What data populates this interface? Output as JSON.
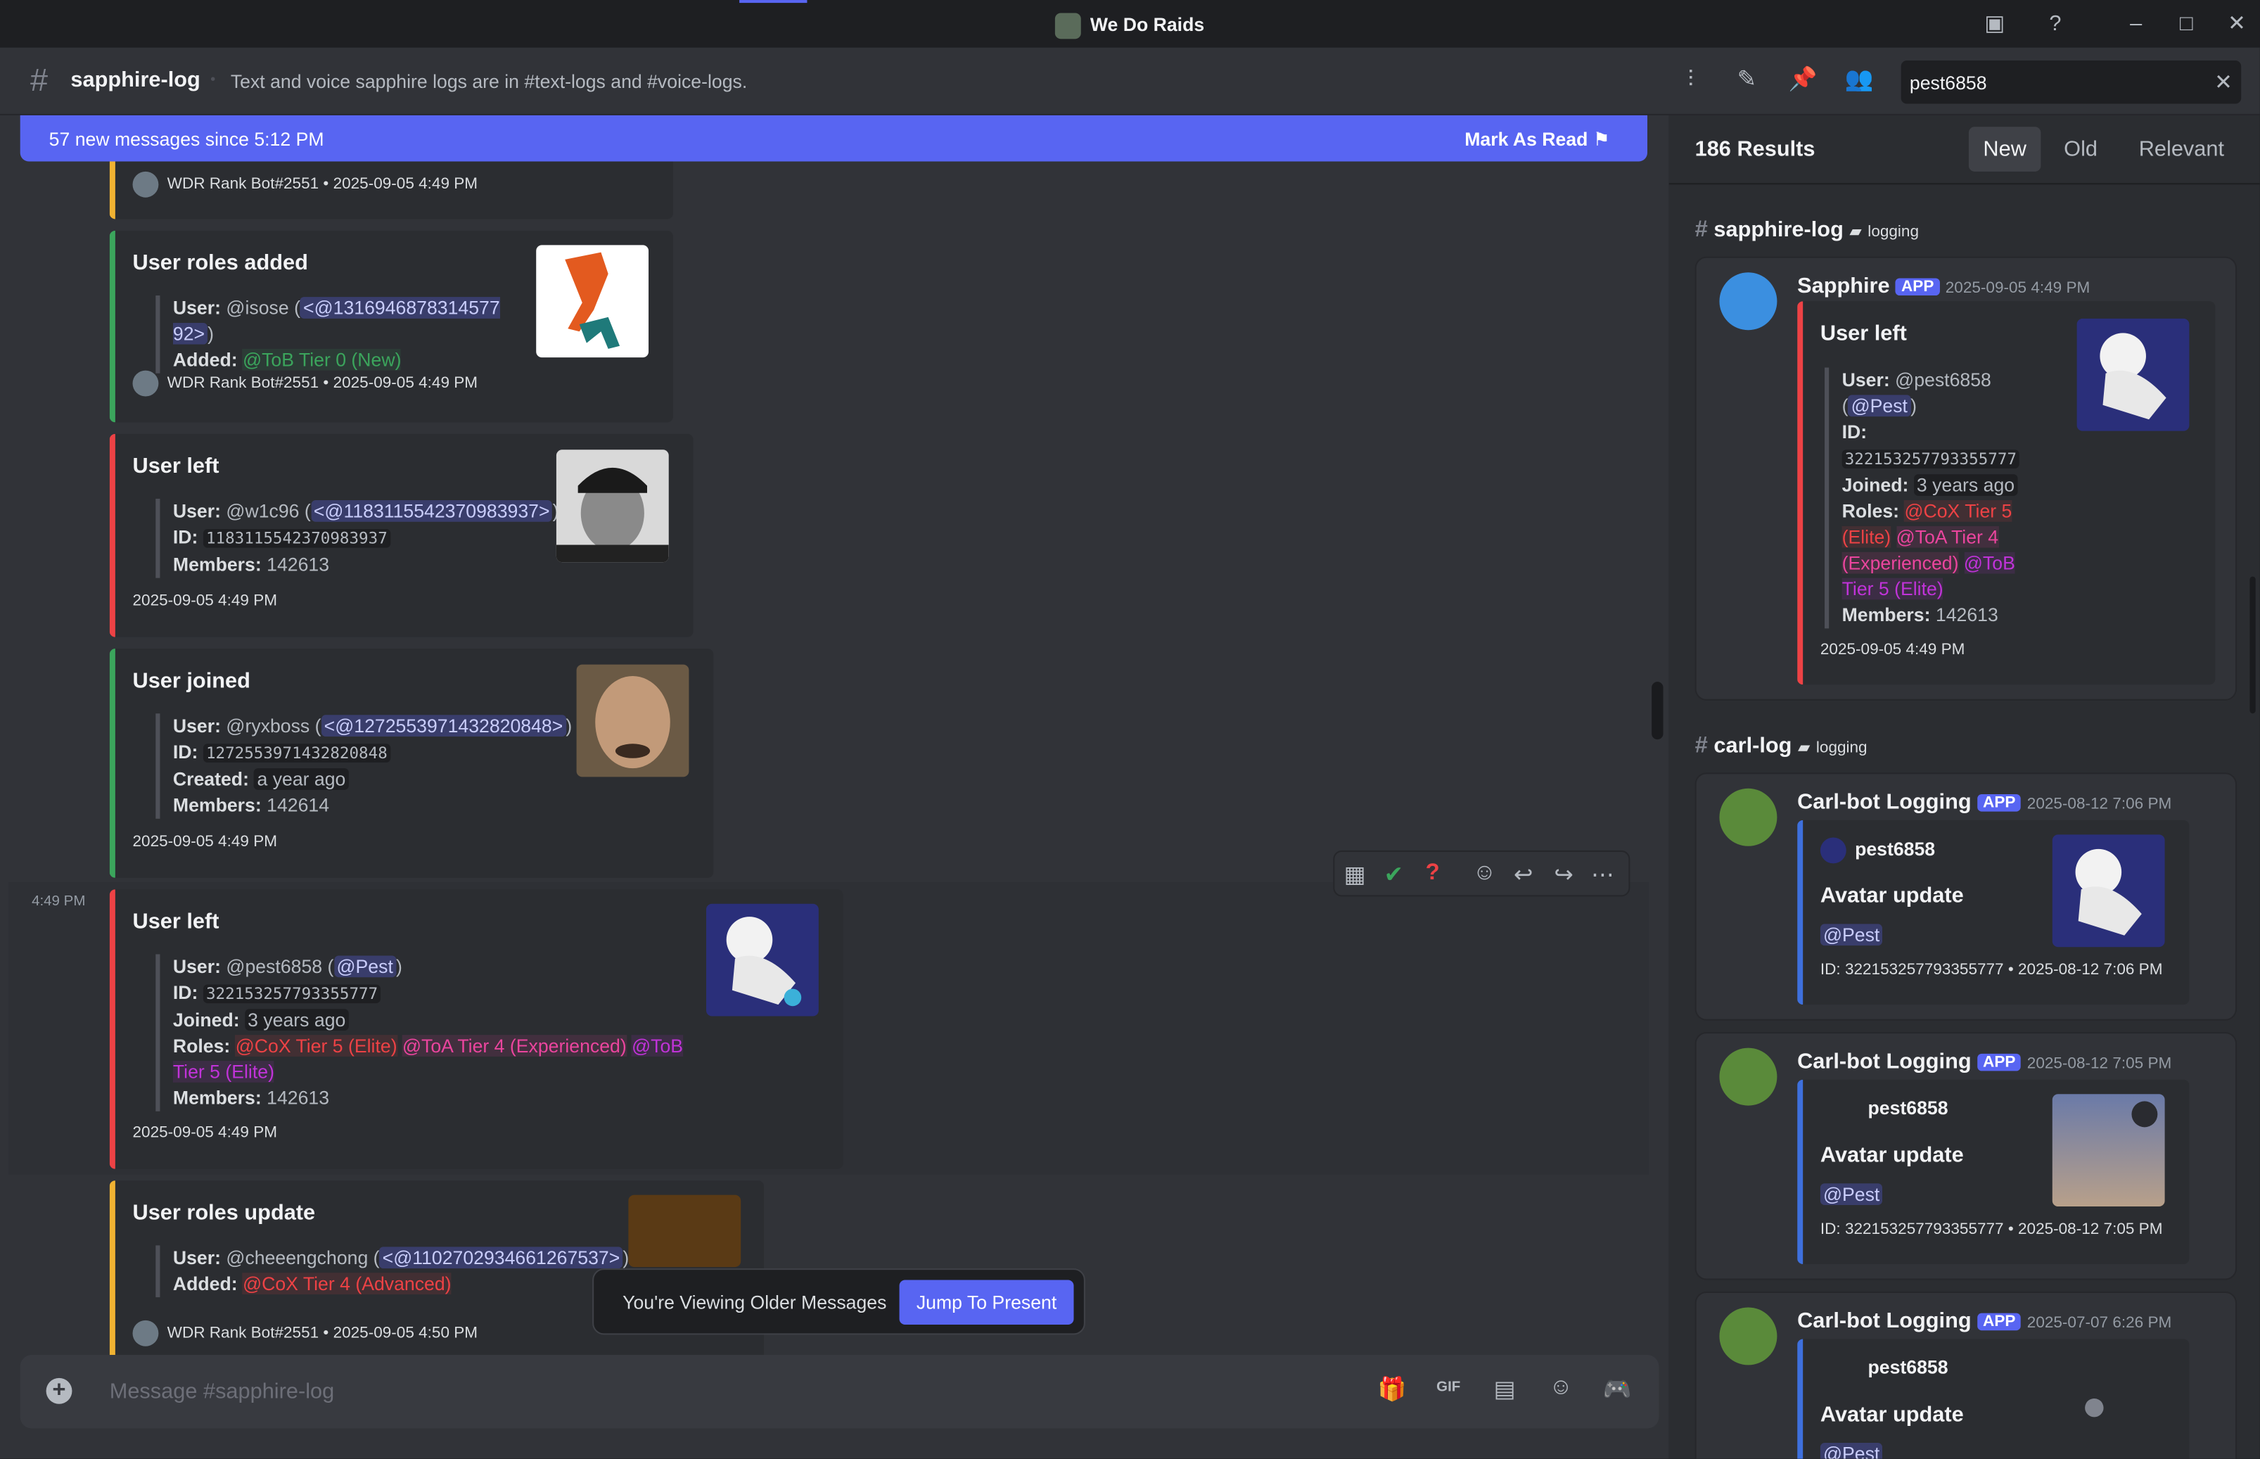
{
  "app": {
    "title": "We Do Raids"
  },
  "channel": {
    "name": "sapphire-log",
    "topic": "Text and voice sapphire logs are in #text-logs and #voice-logs."
  },
  "search": {
    "value": "pest6858"
  },
  "new_messages": {
    "text": "57 new messages since 5:12 PM",
    "action": "Mark As Read"
  },
  "messages": [
    {
      "footer": "WDR Rank Bot#2551 • 2025-09-05 4:49 PM"
    },
    {
      "title": "User roles added",
      "user_label": "User:",
      "user": "@isose",
      "user_id": "<@1316946878314577​92>",
      "added_label": "Added:",
      "role": "@ToB Tier 0 (New)",
      "footer": "WDR Rank Bot#2551 • 2025-09-05 4:49 PM"
    },
    {
      "title": "User left",
      "user_label": "User:",
      "user": "@w1c96",
      "user_id": "<@1183115542370983937>",
      "id_label": "ID:",
      "id": "1183115542370983937",
      "members_label": "Members:",
      "members": "142613",
      "footer": "2025-09-05 4:49 PM"
    },
    {
      "title": "User joined",
      "user_label": "User:",
      "user": "@ryxboss",
      "user_id": "<@1272553971432820848>",
      "id_label": "ID:",
      "id": "1272553971432820848",
      "created_label": "Created:",
      "created": "a year ago",
      "members_label": "Members:",
      "members": "142614",
      "footer": "2025-09-05 4:49 PM"
    },
    {
      "time": "4:49 PM",
      "title": "User left",
      "user_label": "User:",
      "user": "@pest6858",
      "user_mention": "@Pest",
      "id_label": "ID:",
      "id": "322153257793355777",
      "joined_label": "Joined:",
      "joined": "3 years ago",
      "roles_label": "Roles:",
      "role1": "@CoX Tier 5 (Elite)",
      "role2": "@ToA Tier 4 (Experienced)",
      "role3a": "@ToB",
      "role3b": "Tier 5 (Elite)",
      "members_label": "Members:",
      "members": "142613",
      "footer": "2025-09-05 4:49 PM"
    },
    {
      "title": "User roles update",
      "user_label": "User:",
      "user": "@cheeengchong",
      "user_id": "<@1102702934661267537>",
      "added_label": "Added:",
      "role": "@CoX Tier 4 (Advanced)",
      "footer": "WDR Rank Bot#2551 • 2025-09-05 4:50 PM"
    }
  ],
  "older_banner": {
    "text": "You're Viewing Older Messages",
    "button": "Jump To Present"
  },
  "composer": {
    "placeholder": "Message #sapphire-log"
  },
  "search_panel": {
    "results": "186 Results",
    "sort": [
      "New",
      "Old",
      "Relevant"
    ],
    "groups": [
      {
        "channel": "sapphire-log",
        "category": "logging",
        "results": [
          {
            "author": "Sapphire",
            "badge": "APP",
            "date": "2025-09-05 4:49 PM",
            "title": "User left",
            "user_label": "User:",
            "user": "@pest6858",
            "user_mention": "@Pest",
            "id_label": "ID:",
            "id": "322153257793355777",
            "joined_label": "Joined:",
            "joined": "3 years ago",
            "roles_label": "Roles:",
            "r1": "@CoX Tier 5",
            "r2": "(Elite)",
            "r3": "@ToA Tier 4",
            "r4": "(Experienced)",
            "r5": "@ToB",
            "r6": "Tier 5 (Elite)",
            "members_label": "Members:",
            "members": "142613",
            "footer": "2025-09-05 4:49 PM"
          }
        ]
      },
      {
        "channel": "carl-log",
        "category": "logging",
        "results": [
          {
            "author": "Carl-bot Logging",
            "badge": "APP",
            "date": "2025-08-12 7:06 PM",
            "user": "pest6858",
            "title": "Avatar update",
            "mention": "@Pest",
            "footer": "ID: 322153257793355777 • 2025-08-12 7:06 PM"
          },
          {
            "author": "Carl-bot Logging",
            "badge": "APP",
            "date": "2025-08-12 7:05 PM",
            "user": "pest6858",
            "title": "Avatar update",
            "mention": "@Pest",
            "footer": "ID: 322153257793355777 • 2025-08-12 7:05 PM"
          },
          {
            "author": "Carl-bot Logging",
            "badge": "APP",
            "date": "2025-07-07 6:26 PM",
            "user": "pest6858",
            "title": "Avatar update",
            "mention": "@Pest"
          }
        ]
      }
    ]
  },
  "colors": {
    "accent": "#5865f2",
    "green": "#3ba55c",
    "red": "#ed4245",
    "yellow": "#f0b232",
    "blue": "#3e70dd"
  }
}
